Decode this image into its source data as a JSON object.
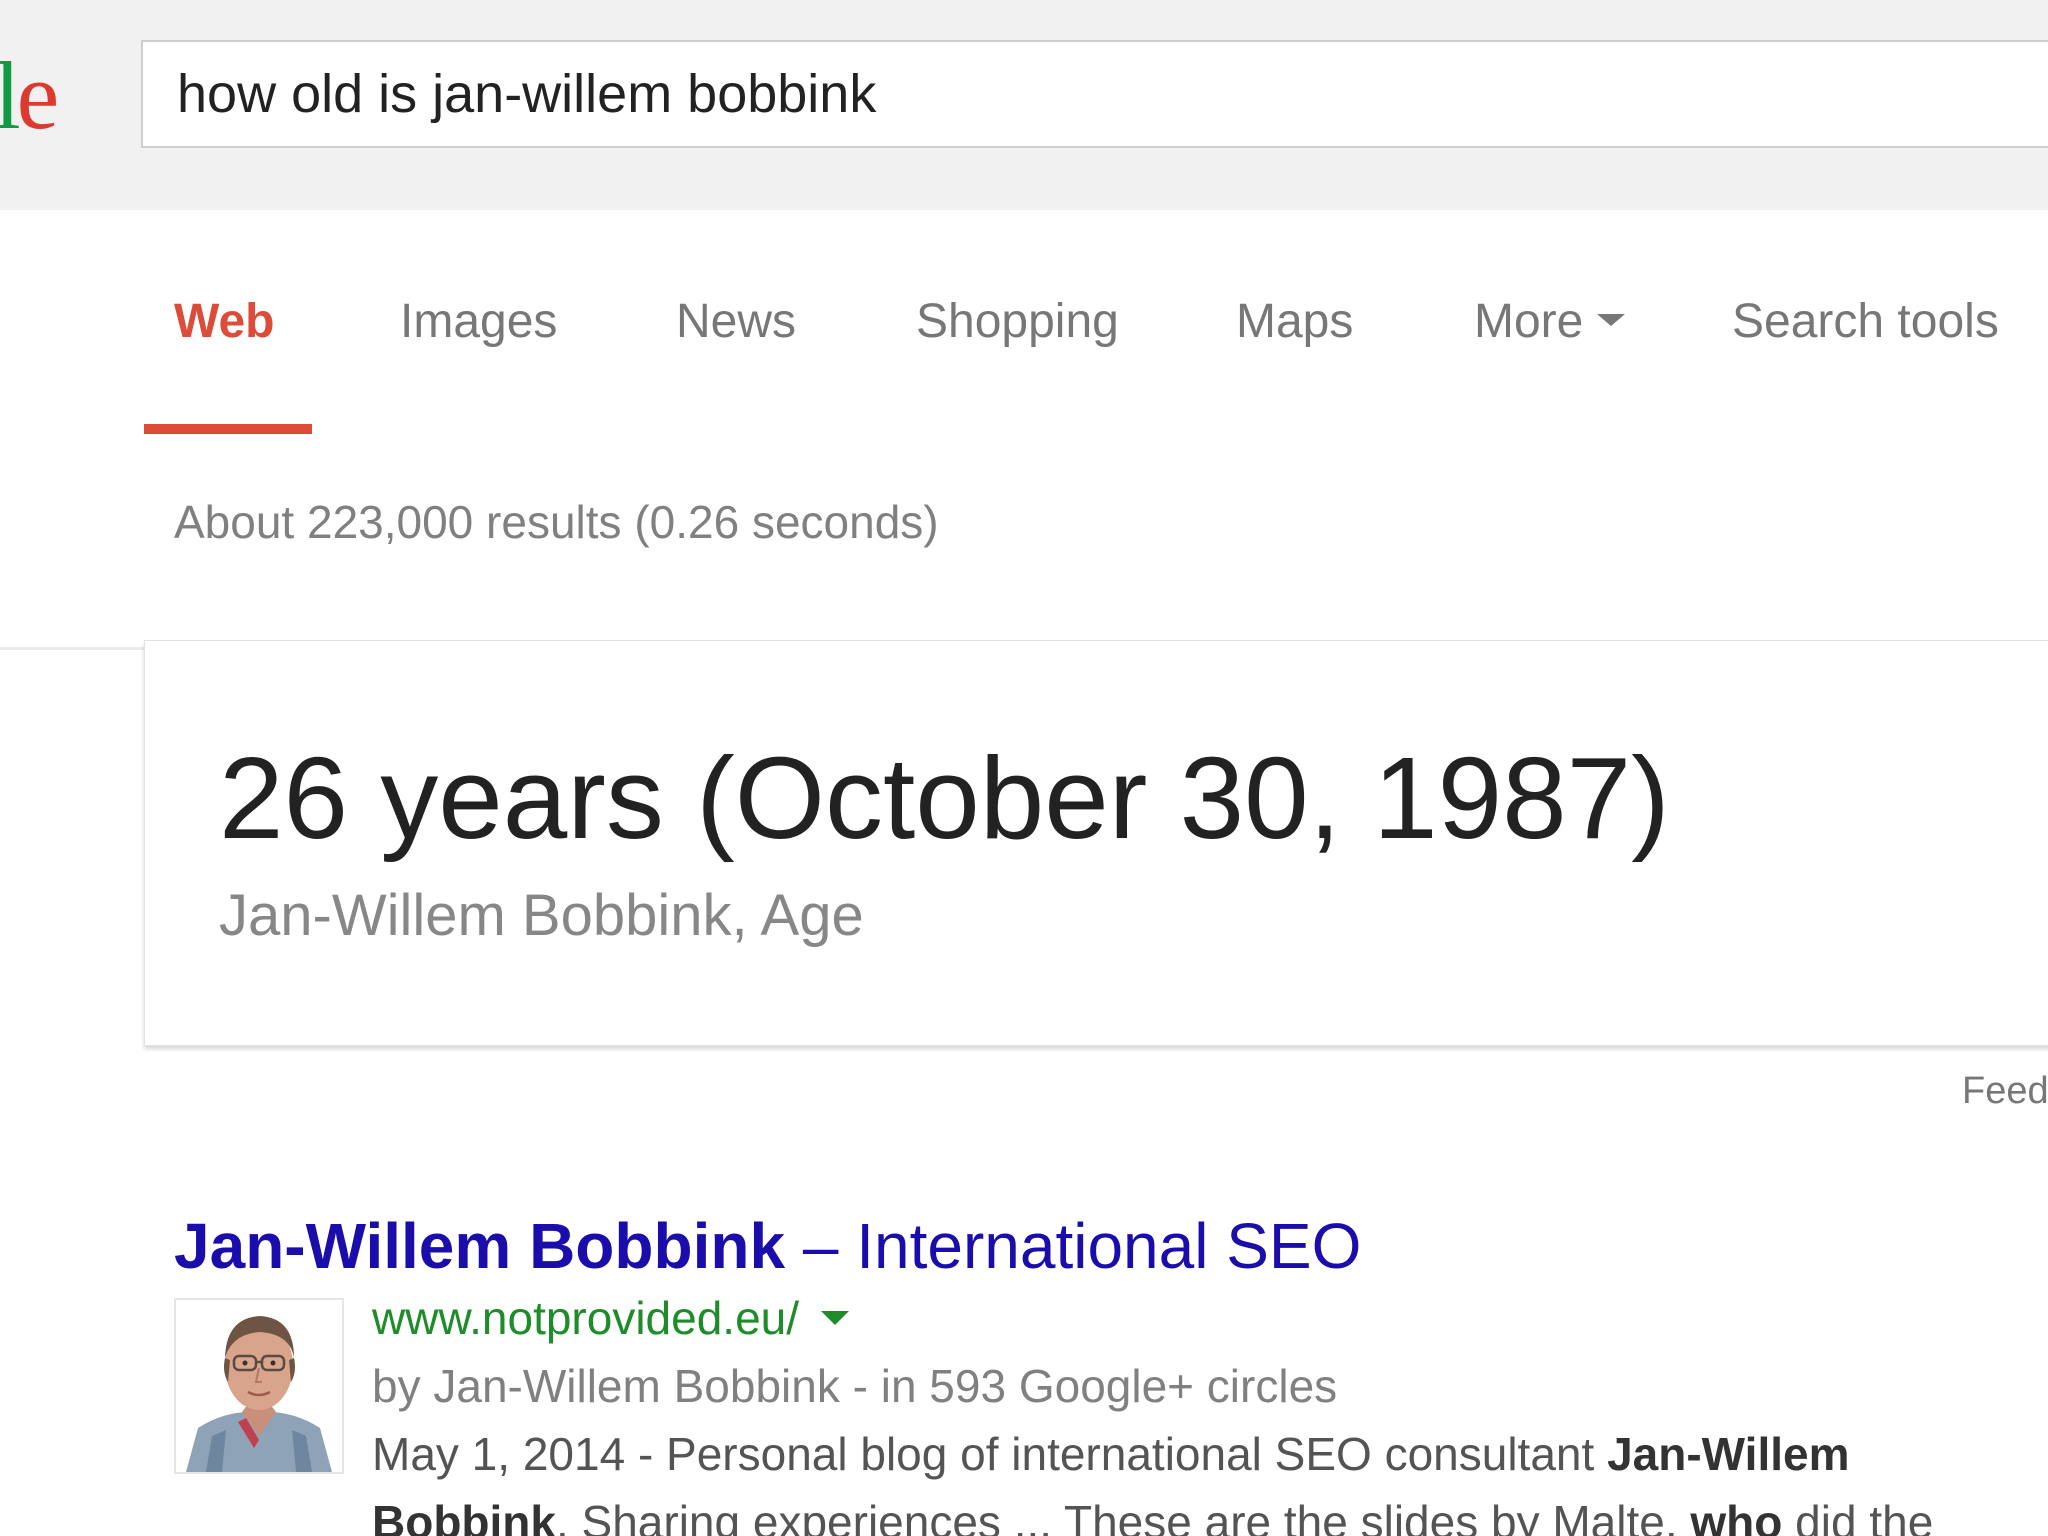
{
  "header": {
    "logo_fragment_l": "l",
    "logo_fragment_e": "e",
    "search_query": "how old is jan-willem bobbink"
  },
  "tabs": [
    {
      "label": "Web",
      "active": true
    },
    {
      "label": "Images",
      "active": false
    },
    {
      "label": "News",
      "active": false
    },
    {
      "label": "Shopping",
      "active": false
    },
    {
      "label": "Maps",
      "active": false
    },
    {
      "label": "More",
      "active": false
    },
    {
      "label": "Search tools",
      "active": false
    }
  ],
  "result_stats": "About 223,000 results (0.26 seconds)",
  "answer_card": {
    "answer": "26 years (October 30, 1987)",
    "subtitle": "Jan-Willem Bobbink, Age",
    "feedback_label": "Feedback"
  },
  "result": {
    "title_bold": "Jan-Willem Bobbink",
    "title_rest": " – International SEO",
    "url": "www.notprovided.eu/",
    "author_line": "by Jan-Willem Bobbink - in 593 Google+ circles",
    "snippet_line1_plain": "May 1, 2014 - Personal blog of international SEO consultant ",
    "snippet_line1_bold": "Jan-Willem",
    "snippet_line2_bold1": "Bobbink",
    "snippet_line2_plain1": ". Sharing experiences ... These are the slides by Malte, ",
    "snippet_line2_bold2": "who",
    "snippet_line2_plain2": " did the"
  },
  "colors": {
    "active_tab": "#dd4b39",
    "link_title": "#1a0dab",
    "url_green": "#1e8c28",
    "header_bg": "#f1f1f1"
  },
  "icons": {
    "more_caret": "caret-down-icon",
    "url_caret": "caret-down-icon"
  }
}
